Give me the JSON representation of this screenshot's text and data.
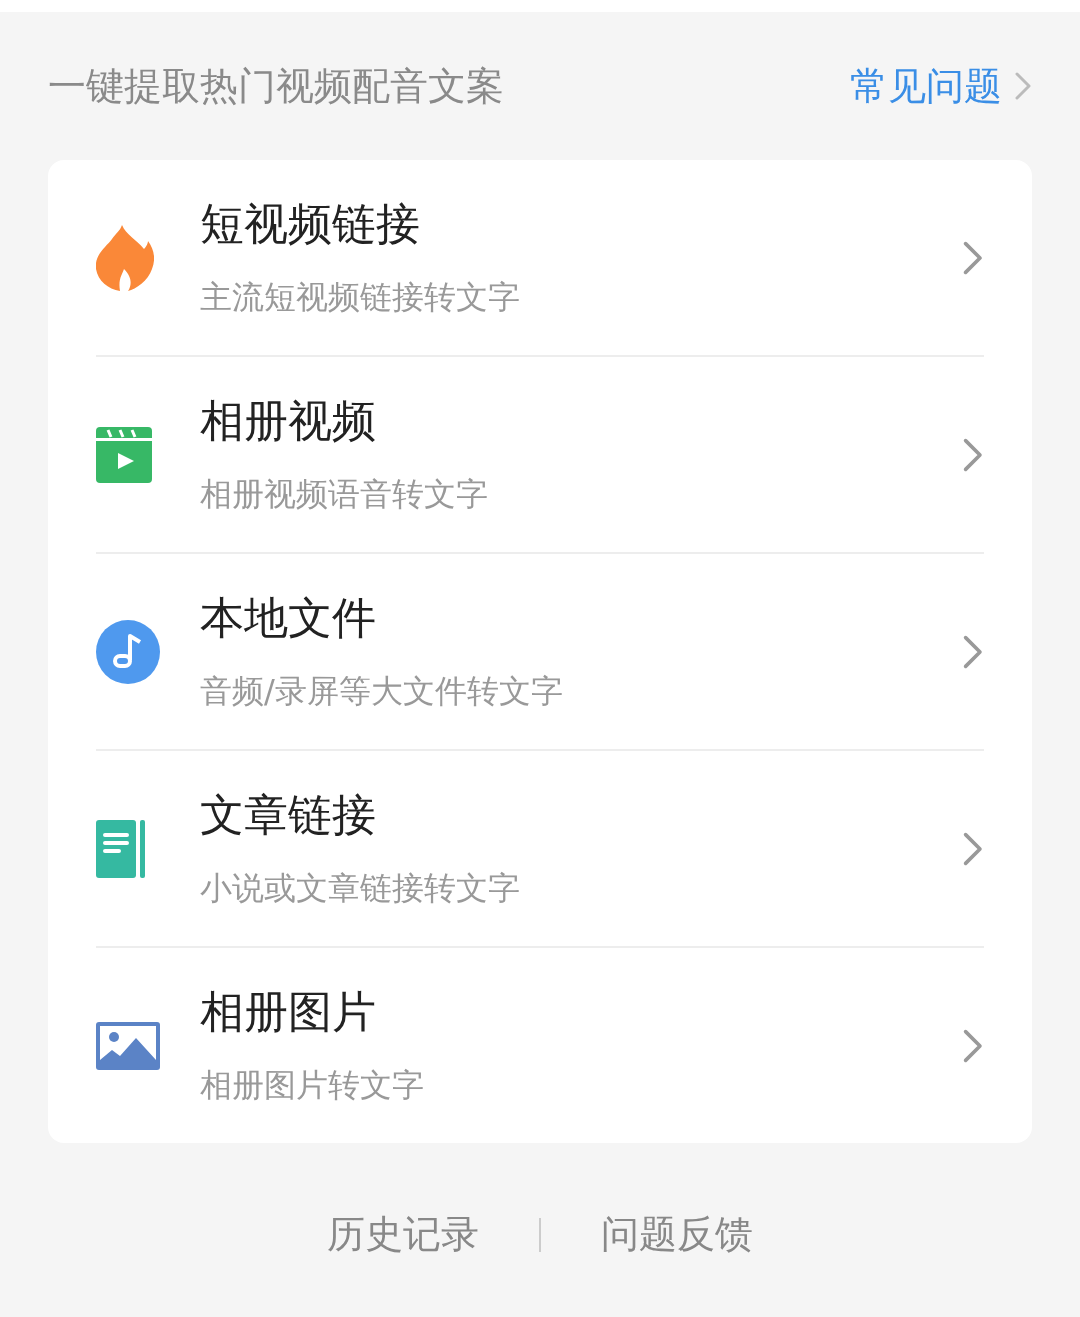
{
  "header": {
    "title": "一键提取热门视频配音文案",
    "faq_link": "常见问题"
  },
  "options": [
    {
      "kind": "flame",
      "title": "短视频链接",
      "subtitle": "主流短视频链接转文字"
    },
    {
      "kind": "clapper",
      "title": "相册视频",
      "subtitle": "相册视频语音转文字"
    },
    {
      "kind": "music",
      "title": "本地文件",
      "subtitle": "音频/录屏等大文件转文字"
    },
    {
      "kind": "document",
      "title": "文章链接",
      "subtitle": "小说或文章链接转文字"
    },
    {
      "kind": "image",
      "title": "相册图片",
      "subtitle": "相册图片转文字"
    }
  ],
  "footer_links": [
    "历史记录",
    "问题反馈"
  ]
}
